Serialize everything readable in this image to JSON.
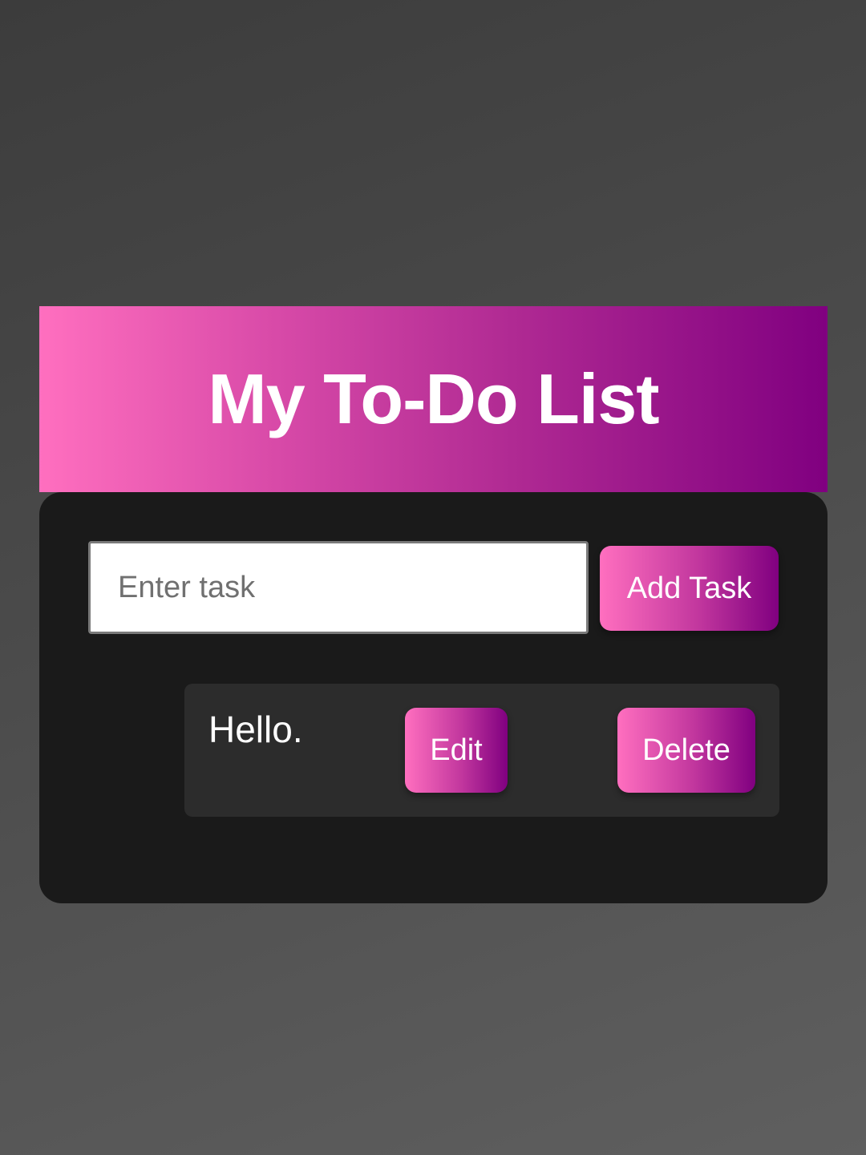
{
  "header": {
    "title": "My To-Do List"
  },
  "form": {
    "input_value": "",
    "input_placeholder": "Enter task",
    "add_button_label": "Add Task"
  },
  "tasks": [
    {
      "text": "Hello.",
      "edit_label": "Edit",
      "delete_label": "Delete"
    }
  ],
  "colors": {
    "gradient_start": "#ff6fbf",
    "gradient_end": "#800080",
    "panel_background": "#1a1a1a",
    "task_background": "#2c2c2c",
    "page_background": "#4b4b4b"
  }
}
